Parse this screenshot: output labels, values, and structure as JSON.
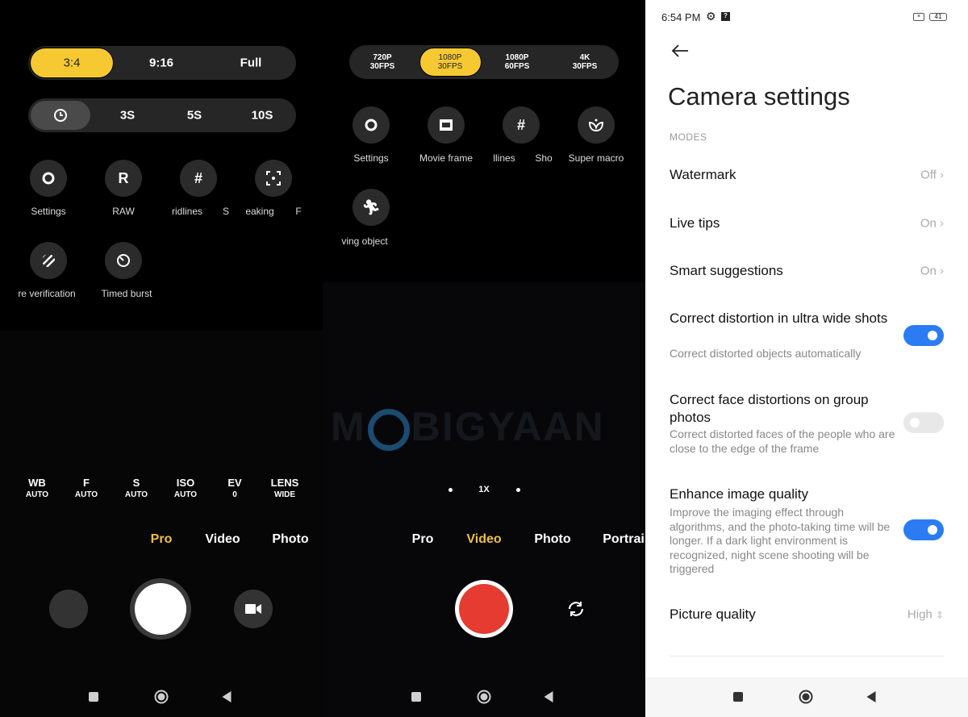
{
  "left": {
    "aspect": [
      "3:4",
      "9:16",
      "Full"
    ],
    "timer": [
      "3S",
      "5S",
      "10S"
    ],
    "icons": [
      {
        "icon": "gear-icon",
        "label": "Settings"
      },
      {
        "icon": "raw-icon",
        "glyph": "R",
        "label": "RAW"
      },
      {
        "icon": "grid-icon",
        "glyph": "#",
        "label": "ridlines"
      },
      {
        "icon": "focus-peaking-icon",
        "label": "eaking"
      },
      {
        "icon": "stripes-icon",
        "label": "re verification"
      },
      {
        "icon": "timer-icon",
        "label": "Timed burst"
      }
    ],
    "cut_labels": [
      "S",
      "F"
    ],
    "params": [
      {
        "a": "WB",
        "b": "AUTO"
      },
      {
        "a": "F",
        "b": "AUTO"
      },
      {
        "a": "S",
        "b": "AUTO"
      },
      {
        "a": "ISO",
        "b": "AUTO"
      },
      {
        "a": "EV",
        "b": "0"
      },
      {
        "a": "LENS",
        "b": "WIDE"
      }
    ],
    "modes": [
      "Pro",
      "Video",
      "Photo"
    ]
  },
  "middle": {
    "resolutions": [
      {
        "a": "720P",
        "b": "30FPS"
      },
      {
        "a": "1080P",
        "b": "30FPS"
      },
      {
        "a": "1080P",
        "b": "60FPS"
      },
      {
        "a": "4K",
        "b": "30FPS"
      }
    ],
    "icons": [
      {
        "icon": "gear-icon",
        "label": "Settings"
      },
      {
        "icon": "movie-frame-icon",
        "label": "Movie frame"
      },
      {
        "icon": "grid-icon",
        "glyph": "#",
        "label": "llines"
      },
      {
        "icon": "super-macro-icon",
        "label": "Super macro"
      },
      {
        "icon": "running-icon",
        "label": "ving object"
      }
    ],
    "cut_label": "Sho",
    "zoom": "1X",
    "modes": [
      "Pro",
      "Video",
      "Photo",
      "Portrai"
    ],
    "watermark": "MOBIGYAAN"
  },
  "settings": {
    "time": "6:54 PM",
    "battery": "41",
    "title": "Camera settings",
    "section": "MODES",
    "rows": [
      {
        "title": "Watermark",
        "value": "Off"
      },
      {
        "title": "Live tips",
        "value": "On"
      },
      {
        "title": "Smart suggestions",
        "value": "On"
      }
    ],
    "toggles": [
      {
        "title": "Correct distortion in ultra wide shots",
        "sub": "Correct distorted objects automatically",
        "on": true
      },
      {
        "title": "Correct face distortions on group photos",
        "sub": "Correct distorted faces of the people who are close to the edge of the frame",
        "on": false
      },
      {
        "title": "Enhance image quality",
        "sub": "Improve the imaging effect through algorithms, and the photo-taking time will be longer. If a dark light environment is recognized, night scene shooting will be triggered",
        "on": true
      }
    ],
    "picture_quality": {
      "title": "Picture quality",
      "value": "High"
    },
    "accent": "#2b7cf3"
  }
}
